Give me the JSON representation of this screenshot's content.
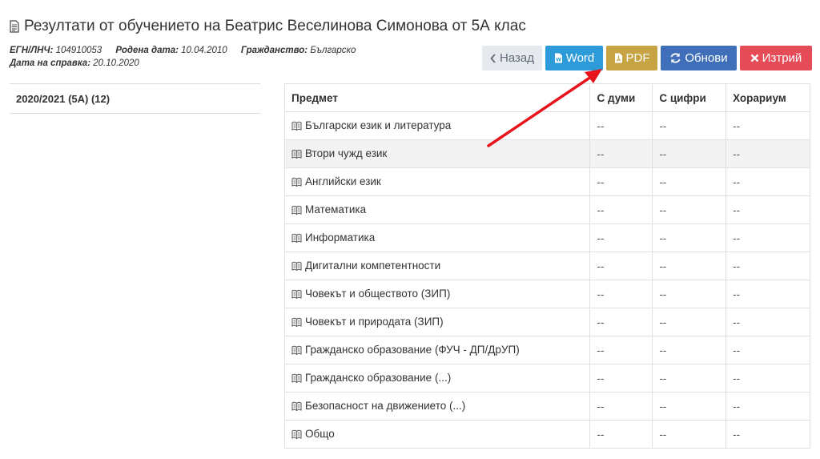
{
  "header": {
    "title": "Резултати от обучението на Беатрис Веселинова Симонова от 5А клас",
    "egn_label": "ЕГН/ЛНЧ:",
    "egn_value": "104910053",
    "born_label": "Родена дата:",
    "born_value": "10.04.2010",
    "citizenship_label": "Гражданство:",
    "citizenship_value": "Българско",
    "date_label": "Дата на справка:",
    "date_value": "20.10.2020"
  },
  "toolbar": {
    "back_label": "Назад",
    "word_label": "Word",
    "pdf_label": "PDF",
    "refresh_label": "Обнови",
    "delete_label": "Изтрий"
  },
  "sidebar": {
    "year_label": "2020/2021 (5А) (12)"
  },
  "table": {
    "columns": [
      "Предмет",
      "С думи",
      "С цифри",
      "Хорариум"
    ],
    "rows": [
      {
        "subject": "Български език и литература",
        "words": "--",
        "digits": "--",
        "hours": "--"
      },
      {
        "subject": "Втори чужд език",
        "words": "--",
        "digits": "--",
        "hours": "--"
      },
      {
        "subject": "Английски език",
        "words": "--",
        "digits": "--",
        "hours": "--"
      },
      {
        "subject": "Математика",
        "words": "--",
        "digits": "--",
        "hours": "--"
      },
      {
        "subject": "Информатика",
        "words": "--",
        "digits": "--",
        "hours": "--"
      },
      {
        "subject": "Дигитални компетентности",
        "words": "--",
        "digits": "--",
        "hours": "--"
      },
      {
        "subject": "Човекът и обществото (ЗИП)",
        "words": "--",
        "digits": "--",
        "hours": "--"
      },
      {
        "subject": "Човекът и природата (ЗИП)",
        "words": "--",
        "digits": "--",
        "hours": "--"
      },
      {
        "subject": "Гражданско образование (ФУЧ - ДП/ДрУП)",
        "words": "--",
        "digits": "--",
        "hours": "--"
      },
      {
        "subject": "Гражданско образование (...)",
        "words": "--",
        "digits": "--",
        "hours": "--"
      },
      {
        "subject": "Безопасност на движението (...)",
        "words": "--",
        "digits": "--",
        "hours": "--"
      },
      {
        "subject": "Общо",
        "words": "--",
        "digits": "--",
        "hours": "--"
      }
    ]
  },
  "icons": {
    "title": "document-icon",
    "back": "chevron-left-icon",
    "word": "file-word-icon",
    "pdf": "file-pdf-icon",
    "refresh": "refresh-icon",
    "delete": "close-icon",
    "subject": "book-icon",
    "annotation": "red-arrow"
  },
  "colors": {
    "word": "#2d9bd9",
    "pdf": "#c7a443",
    "refresh": "#3f6fb8",
    "delete": "#e64c58",
    "back": "#e6e9ed",
    "annotation_arrow": "#e8141c"
  }
}
